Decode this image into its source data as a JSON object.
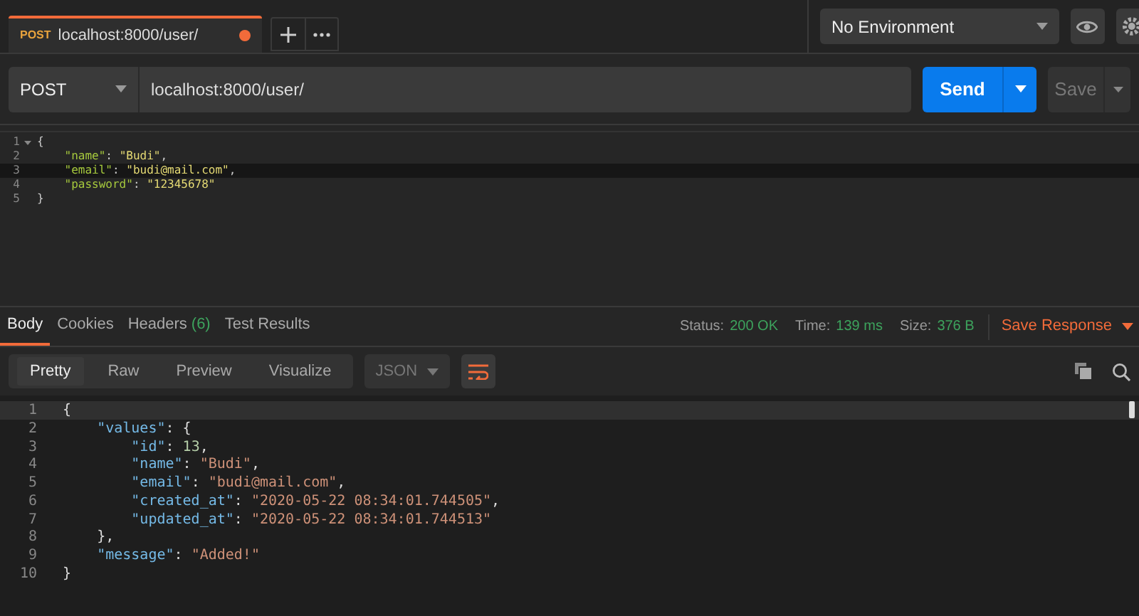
{
  "tabs": [
    {
      "method": "POST",
      "url": "localhost:8000/user/",
      "selected": true,
      "unsaved": true
    }
  ],
  "environment": {
    "value": "No Environment"
  },
  "request": {
    "method": "POST",
    "url": "localhost:8000/user/",
    "send": "Send",
    "save": "Save"
  },
  "request_body": [
    {
      "number": "1",
      "current": false,
      "foldable": true,
      "tokens": [
        {
          "kind": "punct",
          "text": "{"
        }
      ]
    },
    {
      "number": "2",
      "current": false,
      "foldable": false,
      "tokens": [
        {
          "kind": "key",
          "text": "\"name\""
        },
        {
          "kind": "punct",
          "text": ": "
        },
        {
          "kind": "str",
          "text": "\"Budi\""
        },
        {
          "kind": "punct",
          "text": ","
        }
      ]
    },
    {
      "number": "3",
      "current": true,
      "foldable": false,
      "tokens": [
        {
          "kind": "key",
          "text": "\"email\""
        },
        {
          "kind": "punct",
          "text": ": "
        },
        {
          "kind": "str",
          "text": "\"budi@mail.com\""
        },
        {
          "kind": "punct",
          "text": ","
        }
      ]
    },
    {
      "number": "4",
      "current": false,
      "foldable": false,
      "tokens": [
        {
          "kind": "key",
          "text": "\"password\""
        },
        {
          "kind": "punct",
          "text": ": "
        },
        {
          "kind": "str",
          "text": "\"12345678\""
        }
      ]
    },
    {
      "number": "5",
      "current": false,
      "foldable": false,
      "tokens": [
        {
          "kind": "punct",
          "text": "}"
        }
      ]
    }
  ],
  "response_tabs": [
    {
      "label": "Body",
      "selected": true
    },
    {
      "label": "Cookies",
      "selected": false
    },
    {
      "label": "Headers",
      "count": "(6)",
      "selected": false
    },
    {
      "label": "Test Results",
      "selected": false
    }
  ],
  "response_meta": [
    {
      "label": "Status:",
      "value": "200 OK"
    },
    {
      "label": "Time:",
      "value": "139 ms"
    },
    {
      "label": "Size:",
      "value": "376 B"
    }
  ],
  "save_response": "Save Response",
  "view_modes": [
    {
      "label": "Pretty",
      "selected": true
    },
    {
      "label": "Raw",
      "selected": false
    },
    {
      "label": "Preview",
      "selected": false
    },
    {
      "label": "Visualize",
      "selected": false
    }
  ],
  "format": {
    "value": "JSON"
  },
  "wrap_lines": {
    "on": true
  },
  "response_body": [
    {
      "number": "1",
      "current": true,
      "tokens": [
        {
          "kind": "punct",
          "text": "{"
        }
      ]
    },
    {
      "number": "2",
      "current": false,
      "tokens": [
        {
          "kind": "key",
          "text": "\"values\""
        },
        {
          "kind": "punct",
          "text": ": {"
        }
      ]
    },
    {
      "number": "3",
      "current": false,
      "tokens": [
        {
          "kind": "key",
          "text": "\"id\""
        },
        {
          "kind": "punct",
          "text": ": "
        },
        {
          "kind": "num",
          "text": "13"
        },
        {
          "kind": "punct",
          "text": ","
        }
      ]
    },
    {
      "number": "4",
      "current": false,
      "tokens": [
        {
          "kind": "key",
          "text": "\"name\""
        },
        {
          "kind": "punct",
          "text": ": "
        },
        {
          "kind": "str",
          "text": "\"Budi\""
        },
        {
          "kind": "punct",
          "text": ","
        }
      ]
    },
    {
      "number": "5",
      "current": false,
      "tokens": [
        {
          "kind": "key",
          "text": "\"email\""
        },
        {
          "kind": "punct",
          "text": ": "
        },
        {
          "kind": "str",
          "text": "\"budi@mail.com\""
        },
        {
          "kind": "punct",
          "text": ","
        }
      ]
    },
    {
      "number": "6",
      "current": false,
      "tokens": [
        {
          "kind": "key",
          "text": "\"created_at\""
        },
        {
          "kind": "punct",
          "text": ": "
        },
        {
          "kind": "str",
          "text": "\"2020-05-22 08:34:01.744505\""
        },
        {
          "kind": "punct",
          "text": ","
        }
      ]
    },
    {
      "number": "7",
      "current": false,
      "tokens": [
        {
          "kind": "key",
          "text": "\"updated_at\""
        },
        {
          "kind": "punct",
          "text": ": "
        },
        {
          "kind": "str",
          "text": "\"2020-05-22 08:34:01.744513\""
        }
      ]
    },
    {
      "number": "8",
      "current": false,
      "tokens": [
        {
          "kind": "punct",
          "text": "},"
        }
      ]
    },
    {
      "number": "9",
      "current": false,
      "tokens": [
        {
          "kind": "key",
          "text": "\"message\""
        },
        {
          "kind": "punct",
          "text": ": "
        },
        {
          "kind": "str",
          "text": "\"Added!\""
        }
      ]
    },
    {
      "number": "10",
      "current": false,
      "tokens": [
        {
          "kind": "punct",
          "text": "}"
        }
      ]
    }
  ]
}
